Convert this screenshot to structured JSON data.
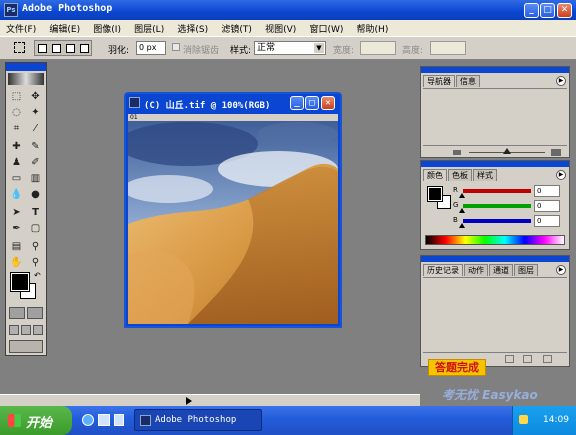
{
  "app": {
    "title": "Adobe Photoshop",
    "icon_label": "Ps"
  },
  "window_controls": {
    "minimize": "_",
    "maximize": "□",
    "close": "✕"
  },
  "menu": [
    "文件(F)",
    "编辑(E)",
    "图像(I)",
    "图层(L)",
    "选择(S)",
    "滤镜(T)",
    "视图(V)",
    "窗口(W)",
    "帮助(H)"
  ],
  "options": {
    "feather_label": "羽化:",
    "feather_value": "0 px",
    "antialias_label": "消除锯齿",
    "style_label": "样式:",
    "style_value": "正常",
    "width_label": "宽度:",
    "height_label": "高度:"
  },
  "document": {
    "title": "(C) 山丘.tif @ 100%(RGB)",
    "badge": "01"
  },
  "panels": {
    "navigator": {
      "tabs": [
        "导航器",
        "信息"
      ]
    },
    "color": {
      "tabs": [
        "颜色",
        "色板",
        "样式"
      ],
      "channels": [
        {
          "label": "R",
          "value": "0",
          "color": "#c00000"
        },
        {
          "label": "G",
          "value": "0",
          "color": "#00a000"
        },
        {
          "label": "B",
          "value": "0",
          "color": "#0000c0"
        }
      ]
    },
    "history": {
      "tabs": [
        "历史记录",
        "动作",
        "通道",
        "图层"
      ]
    }
  },
  "done_button": "答题完成",
  "watermark": "考无忧 Easykao",
  "taskbar": {
    "start": "开始",
    "task": "Adobe Photoshop",
    "clock": "14:09"
  },
  "colors": {
    "accent": "#0a46d1",
    "workspace": "#808080",
    "done_button": "#f5c400"
  }
}
